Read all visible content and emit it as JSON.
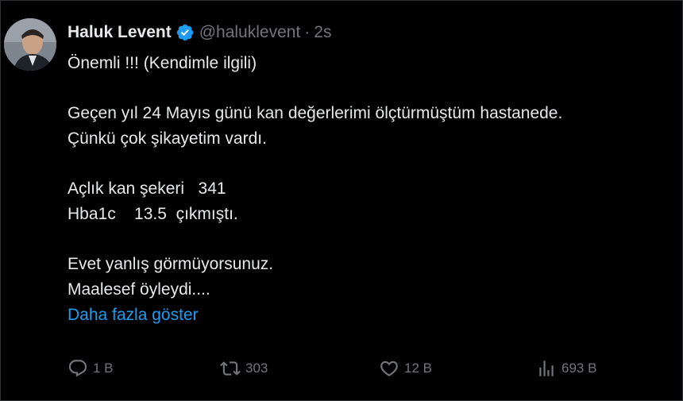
{
  "tweet": {
    "author_name": "Haluk Levent",
    "handle": "@haluklevent",
    "separator": "·",
    "time": "2s",
    "lines": {
      "l1": "Önemli !!! (Kendimle ilgili)",
      "l2": "Geçen yıl 24 Mayıs günü kan değerlerimi ölçtürmüştüm hastanede.",
      "l3": "Çünkü çok şikayetim vardı.",
      "l4": "Açlık kan şekeri   341",
      "l5": "Hba1c    13.5  çıkmıştı.",
      "l6": "Evet yanlış görmüyorsunuz.",
      "l7": "Maalesef öyleydi...."
    },
    "show_more": "Daha fazla göster"
  },
  "actions": {
    "replies": "1 B",
    "reposts": "303",
    "likes": "12 B",
    "views": "693 B"
  },
  "icons": {
    "verified": "verified-badge-icon",
    "reply": "reply-icon",
    "repost": "repost-icon",
    "like": "like-icon",
    "views": "views-icon"
  },
  "colors": {
    "background": "#000000",
    "text": "#e7e9ea",
    "muted": "#71767b",
    "link": "#1d9bf0",
    "verified": "#1d9bf0"
  }
}
